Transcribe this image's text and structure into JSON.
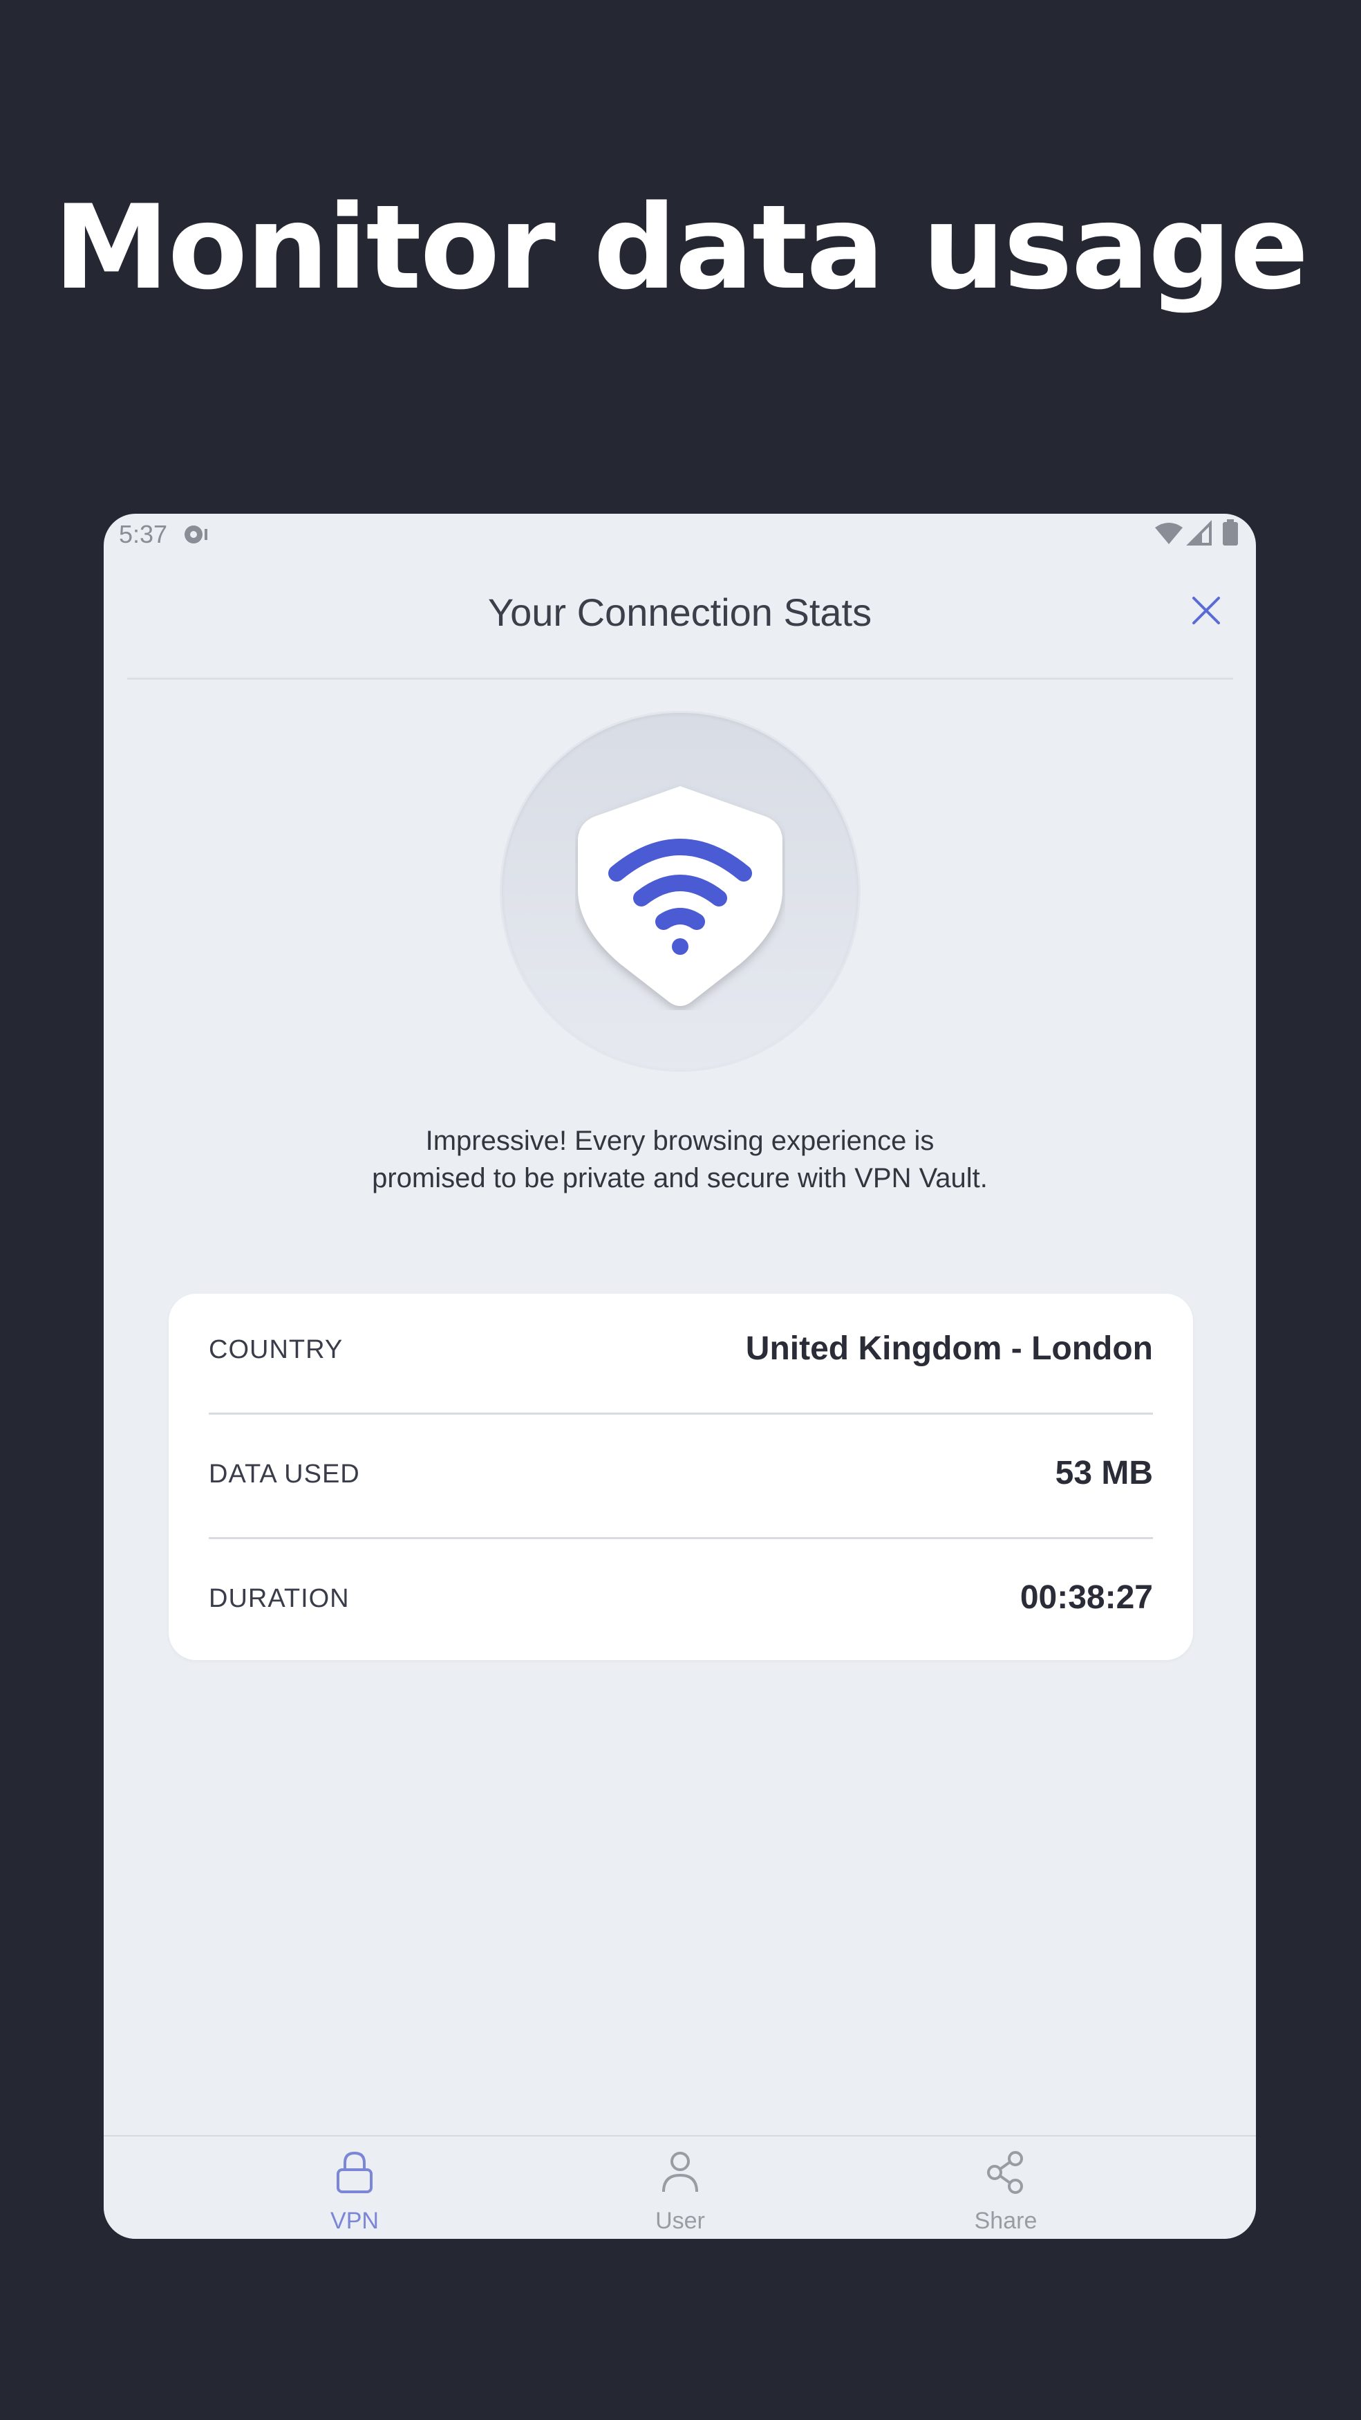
{
  "headline": "Monitor data usage",
  "status_bar": {
    "time": "5:37",
    "icons": [
      "notification-icon",
      "wifi-icon",
      "signal-icon",
      "battery-icon"
    ]
  },
  "app_bar": {
    "title": "Your Connection Stats",
    "close_icon": "close-icon"
  },
  "emblem_icon": "shield-wifi-icon",
  "message": {
    "line1": "Impressive! Every browsing experience is",
    "line2": "promised to be private and secure with VPN Vault."
  },
  "stats": [
    {
      "label": "COUNTRY",
      "value": "United Kingdom - London"
    },
    {
      "label": "DATA USED",
      "value": "53 MB"
    },
    {
      "label": "DURATION",
      "value": "00:38:27"
    }
  ],
  "bottom_nav": {
    "items": [
      {
        "label": "VPN",
        "icon": "lock-icon",
        "active": true
      },
      {
        "label": "User",
        "icon": "user-icon",
        "active": false
      },
      {
        "label": "Share",
        "icon": "share-icon",
        "active": false
      }
    ]
  },
  "colors": {
    "background": "#252833",
    "screen": "#ebeef3",
    "accent": "#4a5bd4",
    "nav_active": "#7b86d6",
    "nav_inactive": "#9a9ca3"
  }
}
